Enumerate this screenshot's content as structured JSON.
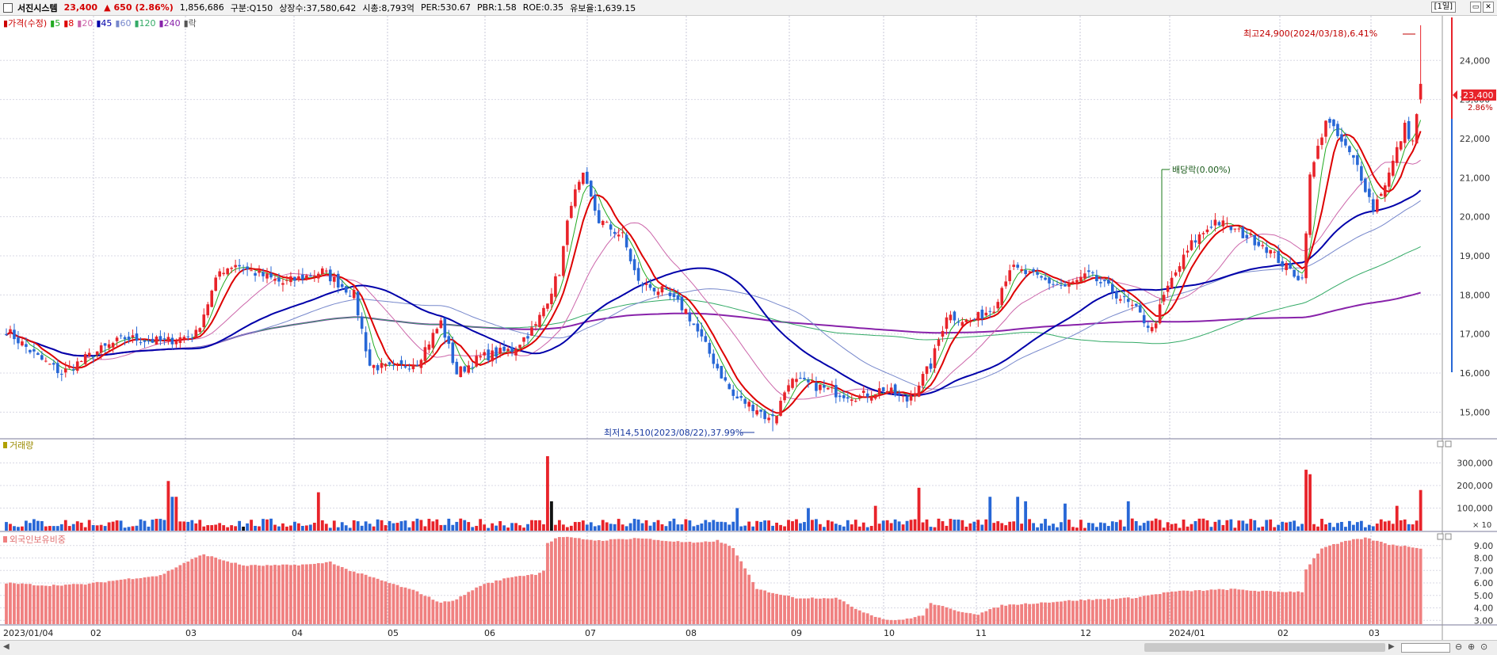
{
  "header": {
    "name": "서진시스템",
    "price": "23,400",
    "change_arrow": "▲",
    "change": "650",
    "change_pct": "(2.86%)",
    "volume": "1,856,686",
    "market": "구분:Q150",
    "shares": "상장수:37,580,642",
    "mktcap": "시총:8,793억",
    "per": "PER:530.67",
    "pbr": "PBR:1.58",
    "roe": "ROE:0.35",
    "turnover": "유보율:1,639.15",
    "period": "[1일]"
  },
  "price_panel": {
    "legend": [
      {
        "text": "가격(수정)",
        "color": "#cc0000"
      },
      {
        "text": "5",
        "color": "#22aa22"
      },
      {
        "text": "8",
        "color": "#dd0000"
      },
      {
        "text": "20",
        "color": "#cc66aa"
      },
      {
        "text": "45",
        "color": "#0000aa"
      },
      {
        "text": "60",
        "color": "#7788cc"
      },
      {
        "text": "120",
        "color": "#33aa66"
      },
      {
        "text": "240",
        "color": "#8822aa"
      },
      {
        "text": "락",
        "color": "#555555"
      }
    ],
    "high_note": "최고24,900(2024/03/18),6.41%",
    "low_note": "최저14,510(2023/08/22),37.99%",
    "dividend_note": "배당락(0.00%)",
    "current_tag": "23,400",
    "current_pct": "2.86%"
  },
  "volume_panel": {
    "legend": "거래량",
    "unit": "× 10"
  },
  "foreign_panel": {
    "legend": "외국인보유비중"
  },
  "xaxis_labels": [
    "2023/01/04",
    "02",
    "03",
    "04",
    "05",
    "06",
    "07",
    "08",
    "09",
    "10",
    "11",
    "12",
    "2024/01",
    "02",
    "03"
  ],
  "colors": {
    "up": "#e8232a",
    "down": "#2767d6",
    "ma5": "#22aa22",
    "ma8": "#dd0000",
    "ma20": "#cc66aa",
    "ma45": "#0000aa",
    "ma60": "#7788cc",
    "ma120": "#33aa66",
    "ma240": "#8822aa",
    "foreign": "#f08080"
  },
  "chart_data": {
    "type": "candlestick",
    "x_range": [
      "2023/01/04",
      "2024/03/19"
    ],
    "price_ylim": [
      14400,
      25100
    ],
    "price_ticks": [
      15000,
      16000,
      17000,
      18000,
      19000,
      20000,
      21000,
      22000,
      23000,
      24000
    ],
    "price_tick_labels": [
      "15,000",
      "16,000",
      "17,000",
      "18,000",
      "19,000",
      "20,000",
      "21,000",
      "22,000",
      "23,000",
      "24,000"
    ],
    "volume_ylim": [
      0,
      400000
    ],
    "volume_ticks": [
      100000,
      200000,
      300000
    ],
    "volume_tick_labels": [
      "100,000",
      "200,000",
      "300,000"
    ],
    "foreign_ylim": [
      2.7,
      10.0
    ],
    "foreign_ticks": [
      3,
      4,
      5,
      6,
      7,
      8,
      9
    ],
    "foreign_tick_labels": [
      "3.00",
      "4.00",
      "5.00",
      "6.00",
      "7.00",
      "8.00",
      "9.00"
    ],
    "price_anchors": [
      [
        0,
        17100
      ],
      [
        8,
        16400
      ],
      [
        14,
        16000
      ],
      [
        22,
        16500
      ],
      [
        30,
        16900
      ],
      [
        40,
        16800
      ],
      [
        48,
        17000
      ],
      [
        54,
        18600
      ],
      [
        58,
        18800
      ],
      [
        62,
        18600
      ],
      [
        70,
        18300
      ],
      [
        80,
        18600
      ],
      [
        88,
        18000
      ],
      [
        92,
        16200
      ],
      [
        98,
        16100
      ],
      [
        104,
        16300
      ],
      [
        110,
        17300
      ],
      [
        114,
        16000
      ],
      [
        120,
        16400
      ],
      [
        128,
        16600
      ],
      [
        134,
        17200
      ],
      [
        140,
        18600
      ],
      [
        143,
        20400
      ],
      [
        146,
        21000
      ],
      [
        150,
        19900
      ],
      [
        156,
        19500
      ],
      [
        160,
        18300
      ],
      [
        166,
        18100
      ],
      [
        172,
        17600
      ],
      [
        178,
        16500
      ],
      [
        184,
        15400
      ],
      [
        190,
        15100
      ],
      [
        194,
        14700
      ],
      [
        198,
        15800
      ],
      [
        204,
        15700
      ],
      [
        210,
        15500
      ],
      [
        216,
        15400
      ],
      [
        222,
        15600
      ],
      [
        228,
        15300
      ],
      [
        234,
        16200
      ],
      [
        238,
        17500
      ],
      [
        244,
        17300
      ],
      [
        250,
        17700
      ],
      [
        254,
        18700
      ],
      [
        262,
        18400
      ],
      [
        268,
        18200
      ],
      [
        274,
        18500
      ],
      [
        280,
        18100
      ],
      [
        286,
        17600
      ],
      [
        290,
        17100
      ],
      [
        294,
        18200
      ],
      [
        300,
        19300
      ],
      [
        306,
        19900
      ],
      [
        312,
        19600
      ],
      [
        318,
        19300
      ],
      [
        324,
        18700
      ],
      [
        328,
        18400
      ],
      [
        330,
        21000
      ],
      [
        334,
        22500
      ],
      [
        338,
        21900
      ],
      [
        342,
        21300
      ],
      [
        346,
        20200
      ],
      [
        350,
        21100
      ],
      [
        354,
        22300
      ],
      [
        356,
        21900
      ],
      [
        358,
        23400
      ]
    ],
    "volume_spikes": [
      [
        41,
        220000
      ],
      [
        42,
        150000
      ],
      [
        43,
        150000
      ],
      [
        79,
        170000
      ],
      [
        137,
        330000
      ],
      [
        138,
        130000
      ],
      [
        185,
        100000
      ],
      [
        203,
        100000
      ],
      [
        220,
        110000
      ],
      [
        231,
        190000
      ],
      [
        249,
        150000
      ],
      [
        256,
        150000
      ],
      [
        258,
        130000
      ],
      [
        268,
        120000
      ],
      [
        284,
        130000
      ],
      [
        329,
        270000
      ],
      [
        330,
        250000
      ],
      [
        352,
        110000
      ],
      [
        358,
        180000
      ]
    ],
    "foreign_anchors": [
      [
        0,
        6.0
      ],
      [
        10,
        5.8
      ],
      [
        20,
        5.9
      ],
      [
        30,
        6.3
      ],
      [
        39,
        6.6
      ],
      [
        45,
        7.6
      ],
      [
        50,
        8.3
      ],
      [
        54,
        7.9
      ],
      [
        60,
        7.4
      ],
      [
        68,
        7.4
      ],
      [
        78,
        7.5
      ],
      [
        82,
        7.7
      ],
      [
        86,
        7.1
      ],
      [
        92,
        6.5
      ],
      [
        98,
        5.9
      ],
      [
        104,
        5.3
      ],
      [
        110,
        4.4
      ],
      [
        114,
        4.7
      ],
      [
        120,
        5.8
      ],
      [
        128,
        6.5
      ],
      [
        134,
        6.7
      ],
      [
        136,
        7.0
      ],
      [
        137,
        9.2
      ],
      [
        140,
        9.7
      ],
      [
        150,
        9.4
      ],
      [
        160,
        9.6
      ],
      [
        166,
        9.4
      ],
      [
        175,
        9.2
      ],
      [
        180,
        9.4
      ],
      [
        184,
        8.8
      ],
      [
        190,
        5.5
      ],
      [
        200,
        4.8
      ],
      [
        210,
        4.8
      ],
      [
        216,
        3.8
      ],
      [
        222,
        3.1
      ],
      [
        226,
        3.0
      ],
      [
        232,
        3.4
      ],
      [
        234,
        4.4
      ],
      [
        240,
        3.8
      ],
      [
        246,
        3.5
      ],
      [
        252,
        4.2
      ],
      [
        270,
        4.6
      ],
      [
        285,
        4.8
      ],
      [
        295,
        5.3
      ],
      [
        310,
        5.5
      ],
      [
        320,
        5.3
      ],
      [
        328,
        5.3
      ],
      [
        329,
        7.1
      ],
      [
        333,
        8.8
      ],
      [
        340,
        9.4
      ],
      [
        344,
        9.6
      ],
      [
        350,
        9.1
      ],
      [
        358,
        8.8
      ]
    ]
  }
}
